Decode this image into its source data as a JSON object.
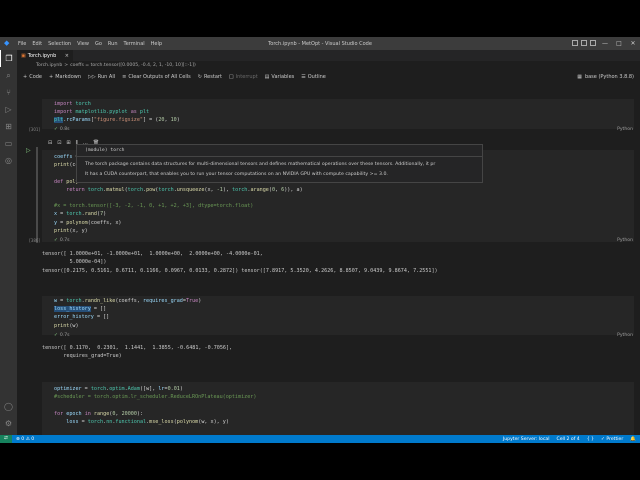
{
  "window": {
    "title": "Torch.ipynb - MetOpt - Visual Studio Code",
    "menu": [
      "File",
      "Edit",
      "Selection",
      "View",
      "Go",
      "Run",
      "Terminal",
      "Help"
    ]
  },
  "tab": {
    "label": "Torch.ipynb"
  },
  "breadcrumb": {
    "file": "Torch.ipynb",
    "sep": ">",
    "sym": "coeffs = torch.tensor([0.0005, -0.4, 2, 1, -10, 10][::-1])"
  },
  "toolbar": {
    "code": "Code",
    "markdown": "Markdown",
    "run_all": "Run All",
    "clear": "Clear Outputs of All Cells",
    "restart": "Restart",
    "interrupt": "Interrupt",
    "variables": "Variables",
    "outline": "Outline",
    "kernel": "base (Python 3.8.8)"
  },
  "cells": {
    "c1": {
      "count": "[301]",
      "time": "0.8s",
      "lang": "Python"
    },
    "c2": {
      "count": "[386]",
      "time": "0.7s",
      "lang": "Python"
    },
    "c3": {
      "time": "0.7s",
      "lang": "Python"
    }
  },
  "hover": {
    "signature": "(module) torch",
    "line1": "The torch package contains data structures for multi-dimensional tensors and defines mathematical operations over these tensors. Additionally, it pr",
    "line2": "It has a CUDA counterpart, that enables you to run your tensor computations on an NVIDIA GPU with compute capability >= 3.0."
  },
  "outputs": {
    "o1": "tensor([ 1.0000e+01, -1.0000e+01,  1.0000e+00,  2.0000e+00, -4.0000e-01,\n         5.0000e-04])\ntensor([0.2175, 0.5161, 0.6711, 0.1166, 0.0967, 0.0133, 0.2872]) tensor([7.8917, 5.3520, 4.2626, 8.8507, 9.0439, 9.8674, 7.2551])",
    "o2": "tensor([ 0.1170,  0.2301,  1.1441,  1.3855, -0.6481, -0.7056],\n       requires_grad=True)"
  },
  "statusbar": {
    "remote": "⇄",
    "problems": "⊗ 0  ⚠ 0",
    "jupyter": "Jupyter Server: local",
    "cell": "Cell 2 of 4",
    "prettier": "✓ Prettier"
  },
  "colors": {
    "accent": "#007acc",
    "editor_bg": "#1e1e1e"
  }
}
